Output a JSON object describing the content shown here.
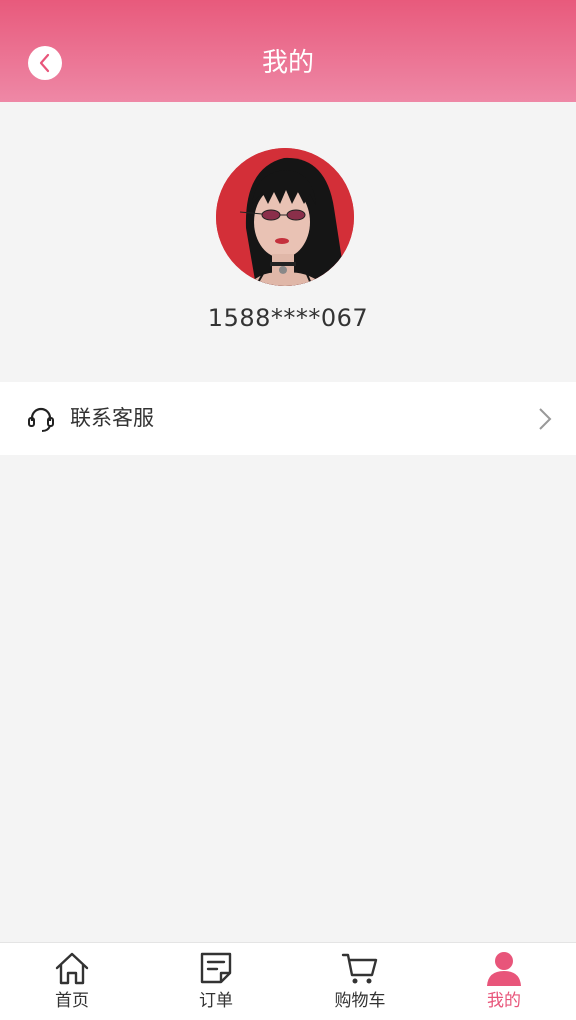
{
  "header": {
    "title": "我的",
    "back_icon": "chevron-left-icon"
  },
  "profile": {
    "avatar_desc": "avatar",
    "phone": "1588****067"
  },
  "menu": [
    {
      "label": "联系客服",
      "icon": "headset-icon"
    }
  ],
  "tabbar": [
    {
      "label": "首页",
      "icon": "home-icon",
      "active": false
    },
    {
      "label": "订单",
      "icon": "order-note-icon",
      "active": false
    },
    {
      "label": "购物车",
      "icon": "cart-icon",
      "active": false
    },
    {
      "label": "我的",
      "icon": "user-icon",
      "active": true
    }
  ],
  "colors": {
    "accent": "#e8557a",
    "header_top": "#e85a7c",
    "header_bottom": "#ee88a6",
    "background": "#f4f4f4"
  }
}
